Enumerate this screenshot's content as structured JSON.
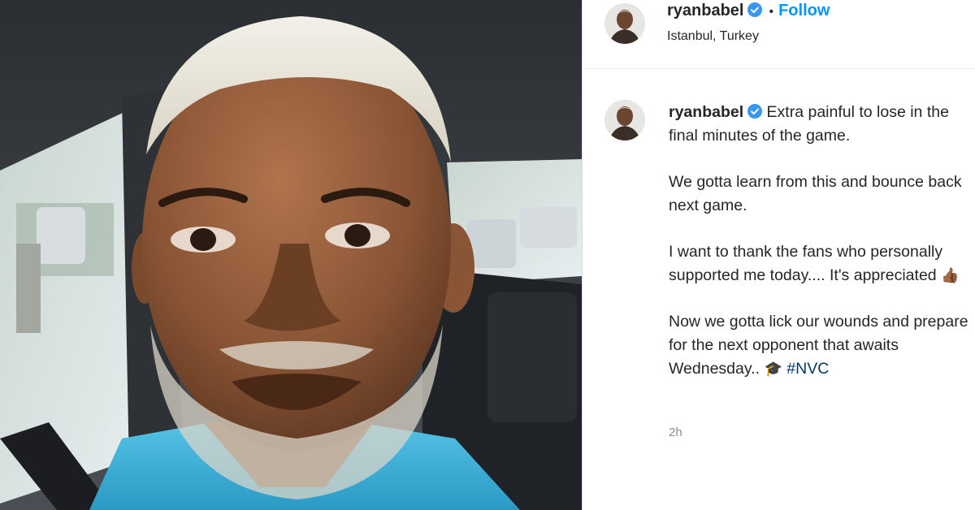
{
  "post": {
    "username": "ryanbabel",
    "follow_label": "Follow",
    "separator": "•",
    "location": "Istanbul, Turkey",
    "caption_username": "ryanbabel",
    "caption_p1": "Extra painful to lose in the final minutes of the game.",
    "caption_p2": "We gotta learn from this and bounce back next game.",
    "caption_p3": "I want to thank the fans who personally supported me today.... It's appreciated",
    "caption_p3_emoji": "👍🏾",
    "caption_p4": "Now we gotta lick our wounds and prepare for the next opponent that awaits Wednesday..",
    "caption_p4_emoji": "🎓",
    "hashtag": "#NVC",
    "timestamp": "2h"
  },
  "icons": {
    "verified": "verified-badge-icon",
    "thumbs_up": "thumbs-up-emoji",
    "grad_cap": "graduation-cap-emoji"
  },
  "colors": {
    "link_blue": "#0095f6",
    "hashtag": "#00376b",
    "text": "#262626",
    "muted": "#8e8e8e",
    "shirt": "#3fb0d8"
  }
}
